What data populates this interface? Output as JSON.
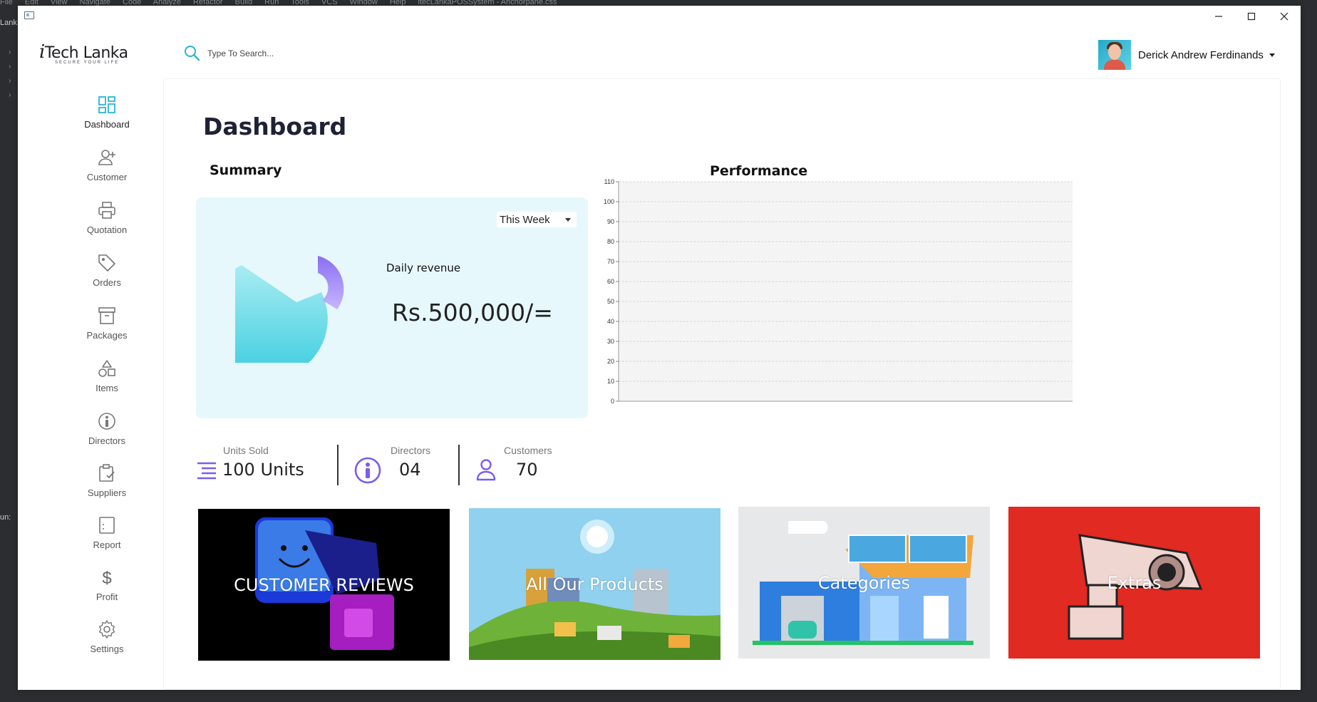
{
  "ide": {
    "menu": [
      "File",
      "Edit",
      "View",
      "Navigate",
      "Code",
      "Analyze",
      "Refactor",
      "Build",
      "Run",
      "Tools",
      "VCS",
      "Window",
      "Help"
    ],
    "project_title": "itecLankaPOSSystem - Anchorpane.css",
    "left_label": "Lank",
    "run_label": "un:"
  },
  "app": {
    "brand_name": "Tech Lanka",
    "brand_prefix": "i",
    "brand_tagline": "SECURE YOUR LIFE",
    "window_buttons": [
      "minimize",
      "maximize",
      "close"
    ]
  },
  "search": {
    "placeholder": "Type To Search..."
  },
  "user": {
    "name": "Derick Andrew Ferdinands"
  },
  "sidebar": {
    "items": [
      {
        "label": "Dashboard",
        "icon": "dashboard-icon",
        "active": true
      },
      {
        "label": "Customer",
        "icon": "add-user-icon"
      },
      {
        "label": "Quotation",
        "icon": "printer-icon"
      },
      {
        "label": "Orders",
        "icon": "tag-icon"
      },
      {
        "label": "Packages",
        "icon": "archive-box-icon"
      },
      {
        "label": "Items",
        "icon": "shapes-icon"
      },
      {
        "label": "Directors",
        "icon": "person-circle-icon"
      },
      {
        "label": "Suppliers",
        "icon": "clipboard-check-icon"
      },
      {
        "label": "Report",
        "icon": "report-icon"
      },
      {
        "label": "Profit",
        "icon": "dollar-icon"
      },
      {
        "label": "Settings",
        "icon": "gear-icon"
      }
    ]
  },
  "main": {
    "title": "Dashboard",
    "summary": {
      "heading": "Summary",
      "period": "This Week",
      "revenue_label": "Daily revenue",
      "revenue_value": "Rs.500,000/=",
      "accent": "#7b5cf0",
      "donut_color": "#5fd4e3"
    },
    "stats": [
      {
        "caption": "Units Sold",
        "value": "100 Units",
        "icon": "list-lines-icon"
      },
      {
        "caption": "Directors",
        "value": "04",
        "icon": "person-circle-icon"
      },
      {
        "caption": "Customers",
        "value": "70",
        "icon": "user-icon"
      }
    ],
    "performance": {
      "heading": "Performance"
    },
    "tiles": [
      {
        "label": "CUSTOMER REVIEWS"
      },
      {
        "label": "All Our Products"
      },
      {
        "label": "Categories"
      },
      {
        "label": "Extras"
      }
    ]
  },
  "chart_data": {
    "type": "line",
    "title": "Performance",
    "x": [],
    "series": [],
    "ylim": [
      0,
      110
    ],
    "yticks": [
      0,
      10,
      20,
      30,
      40,
      50,
      60,
      70,
      80,
      90,
      100,
      110
    ],
    "grid": true
  }
}
